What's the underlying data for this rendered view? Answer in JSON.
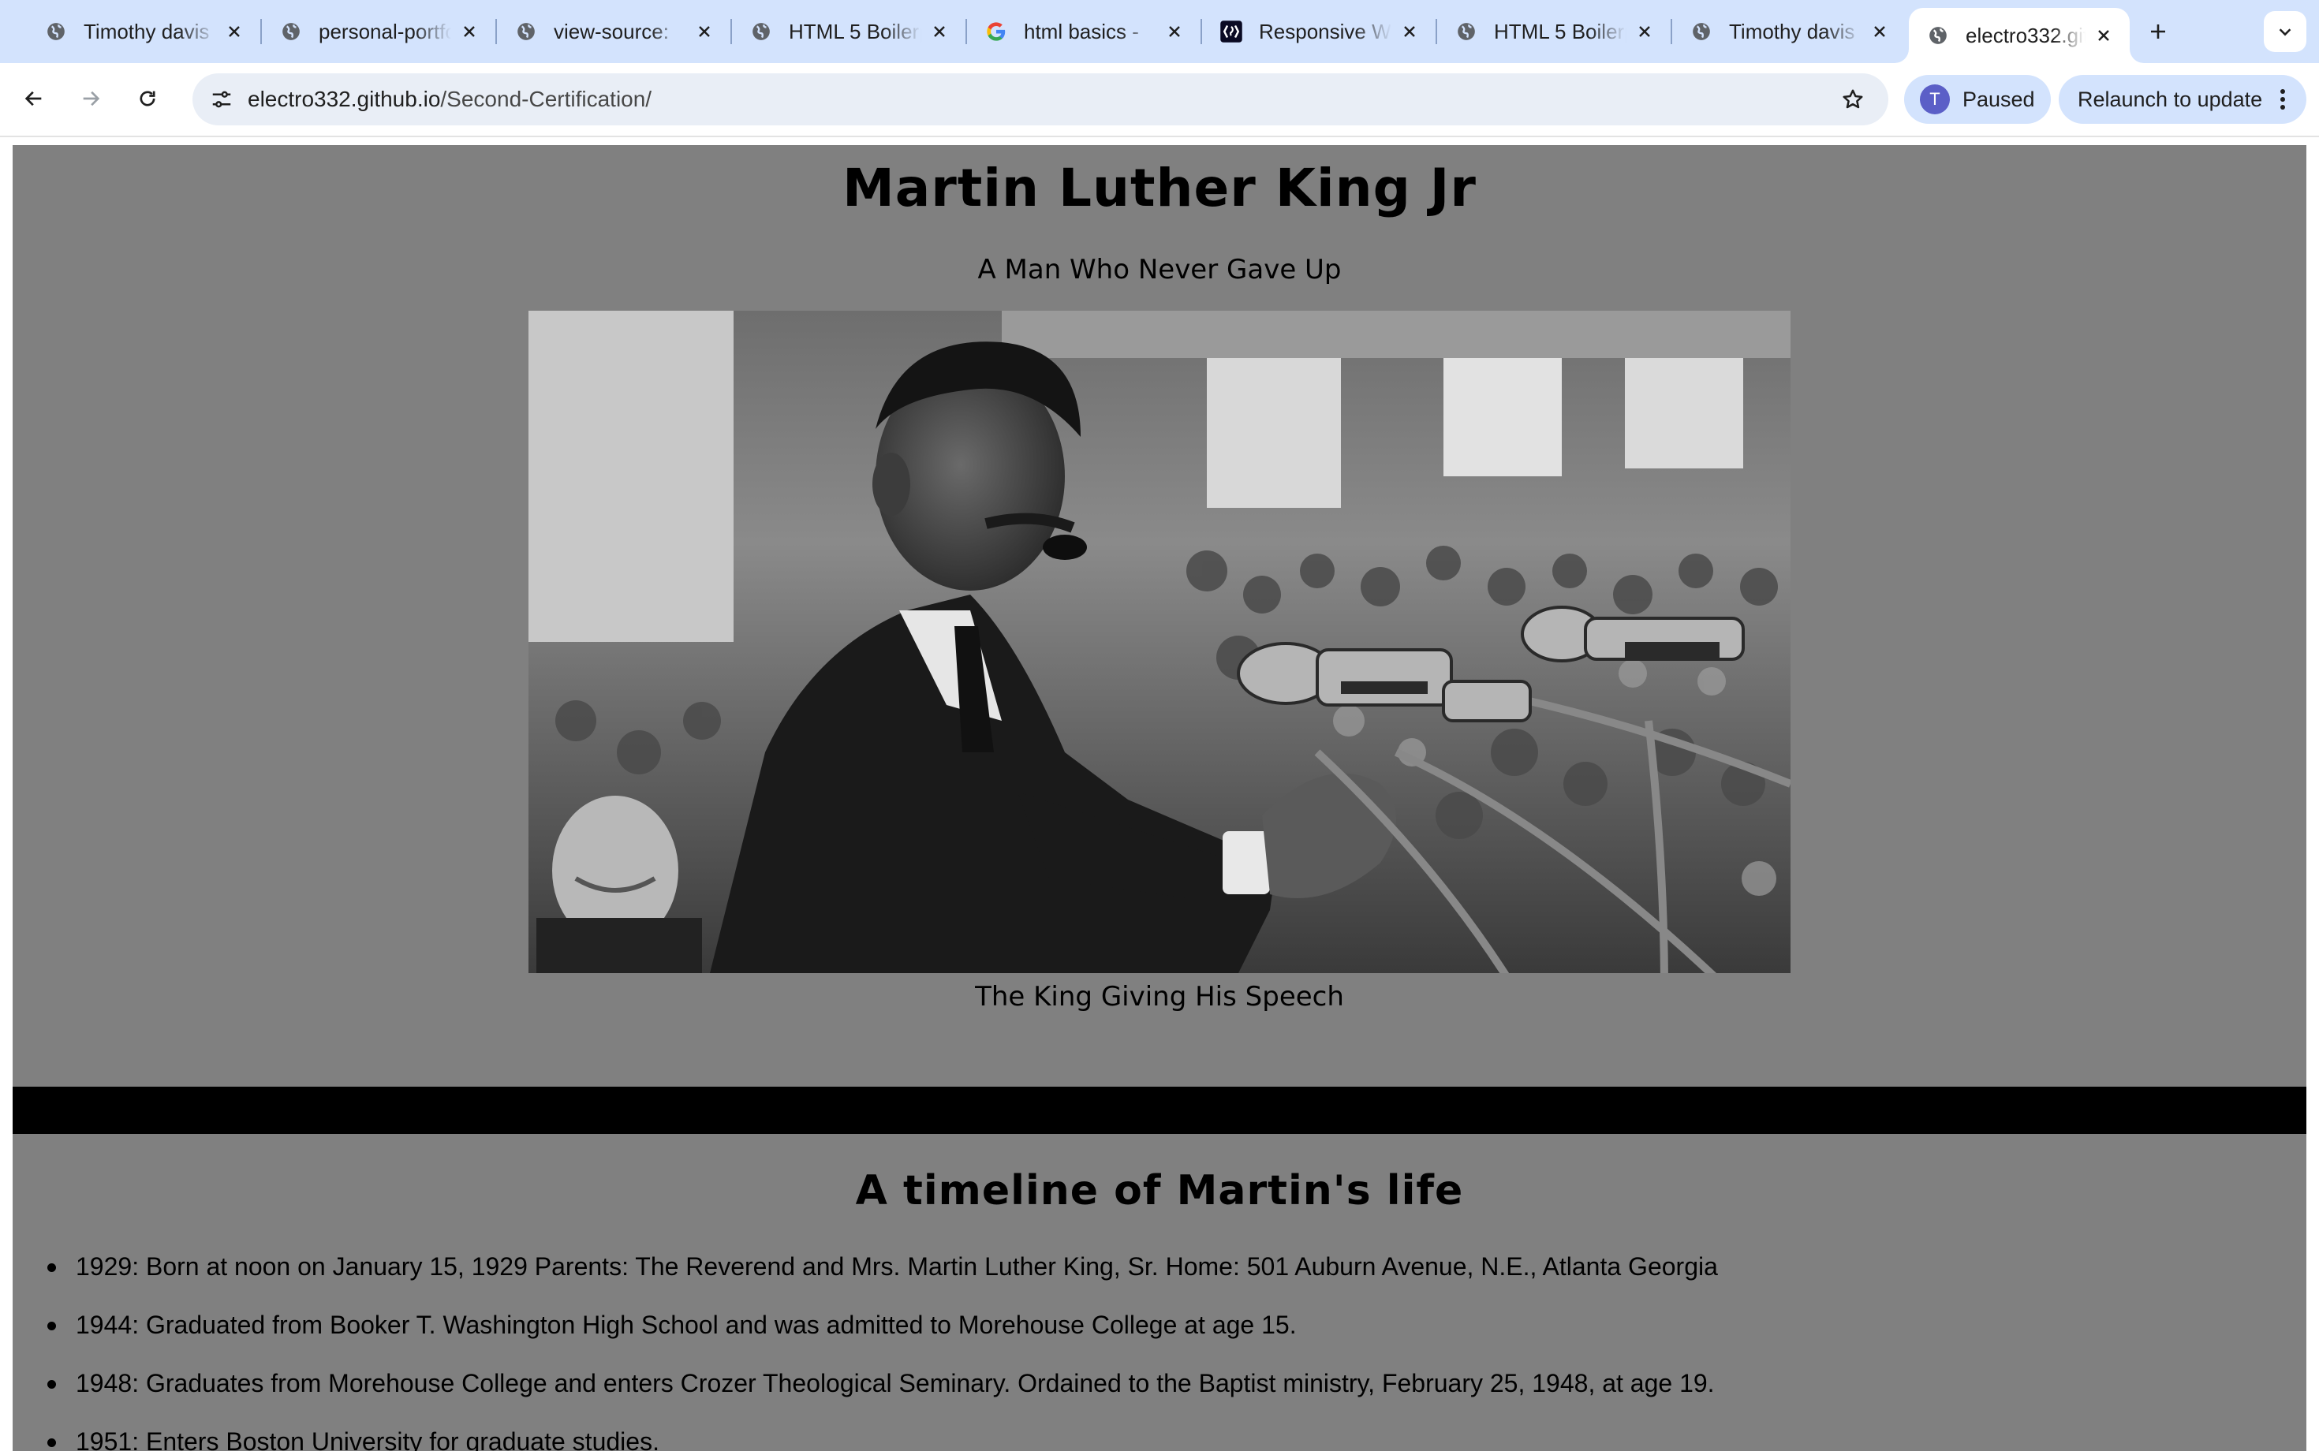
{
  "browser": {
    "tabs": [
      {
        "title": "Timothy davis",
        "favicon": "globe-icon",
        "active": false
      },
      {
        "title": "personal-portfolio",
        "favicon": "globe-icon",
        "active": false
      },
      {
        "title": "view-source:",
        "favicon": "globe-icon",
        "active": false
      },
      {
        "title": "HTML 5 Boilerplate",
        "favicon": "globe-icon",
        "active": false
      },
      {
        "title": "html basics -",
        "favicon": "google-icon",
        "active": false
      },
      {
        "title": "Responsive Web",
        "favicon": "freecodecamp-icon",
        "active": false
      },
      {
        "title": "HTML 5 Boilerplate",
        "favicon": "globe-icon",
        "active": false
      },
      {
        "title": "Timothy davis",
        "favicon": "globe-icon",
        "active": false
      },
      {
        "title": "electro332.github.io",
        "favicon": "globe-icon",
        "active": true
      }
    ],
    "address": {
      "domain": "electro332.github.io",
      "path": "/Second-Certification/"
    },
    "profile": {
      "initial": "T",
      "label": "Paused"
    },
    "relaunch_label": "Relaunch to update",
    "colors": {
      "tabstrip": "#d3e3fd",
      "omnibox": "#e9eef6",
      "avatar": "#5b5fc7"
    }
  },
  "page": {
    "title": "Martin Luther King Jr",
    "tagline": "A Man Who Never Gave Up",
    "image": {
      "subject": "Martin Luther King Jr speaking at microphones before a crowd (black and white photo)"
    },
    "caption": "The King Giving His Speech",
    "timeline": {
      "heading": "A timeline of Martin's life",
      "items": [
        "1929: Born at noon on January 15, 1929 Parents: The Reverend and Mrs. Martin Luther King, Sr. Home: 501 Auburn Avenue, N.E., Atlanta Georgia",
        "1944: Graduated from Booker T. Washington High School and was admitted to Morehouse College at age 15.",
        "1948: Graduates from Morehouse College and enters Crozer Theological Seminary. Ordained to the Baptist ministry, February 25, 1948, at age 19.",
        "1951: Enters Boston University for graduate studies."
      ]
    },
    "colors": {
      "section_bg": "#808080",
      "divider": "#000000",
      "text": "#000000"
    }
  }
}
